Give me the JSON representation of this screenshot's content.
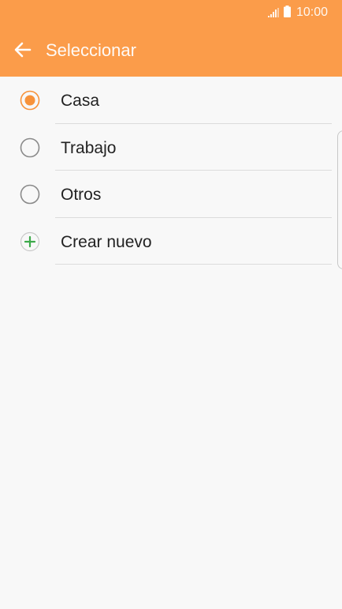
{
  "status_bar": {
    "time": "10:00",
    "signal_icon": "signal-icon",
    "battery_icon": "battery-icon"
  },
  "header": {
    "title": "Seleccionar",
    "back_icon": "arrow-left-icon",
    "background_color": "#fb9c4a"
  },
  "options": [
    {
      "label": "Casa",
      "type": "radio",
      "selected": true
    },
    {
      "label": "Trabajo",
      "type": "radio",
      "selected": false
    },
    {
      "label": "Otros",
      "type": "radio",
      "selected": false
    },
    {
      "label": "Crear nuevo",
      "type": "add",
      "icon": "plus-icon"
    }
  ],
  "colors": {
    "accent": "#f7923a",
    "radio_unselected": "#8a8a8a",
    "add_icon": "#3daa4a"
  }
}
